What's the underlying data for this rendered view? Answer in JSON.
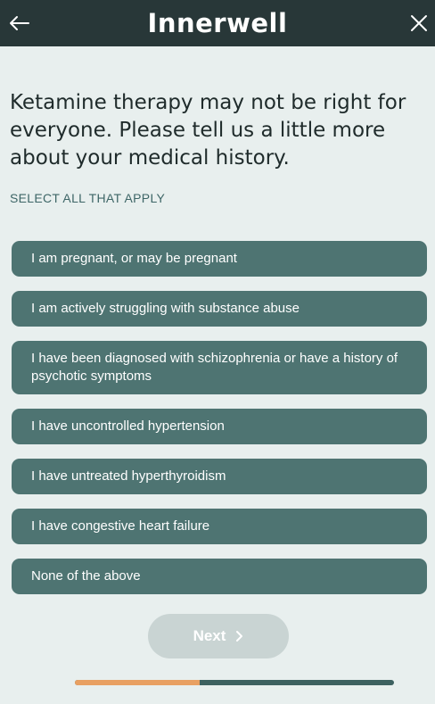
{
  "header": {
    "logo_text": "Innerwell",
    "back_icon": "arrow-left-icon",
    "close_icon": "close-icon"
  },
  "question": {
    "text": "Ketamine therapy may not be right for everyone. Please tell us a little more about your medical history.",
    "instruction": "SELECT ALL THAT APPLY"
  },
  "options": [
    {
      "label": "I am pregnant, or may be pregnant"
    },
    {
      "label": "I am actively struggling with substance abuse"
    },
    {
      "label": "I have been diagnosed with schizophrenia or have a history of psychotic symptoms"
    },
    {
      "label": "I have uncontrolled hypertension"
    },
    {
      "label": "I have untreated hyperthyroidism"
    },
    {
      "label": "I have congestive heart failure"
    },
    {
      "label": "None of the above"
    }
  ],
  "next_button": {
    "label": "Next",
    "disabled": true
  },
  "progress": {
    "fraction": 0.39
  },
  "colors": {
    "header_bg": "#283738",
    "option_bg": "#4e7472",
    "page_bg": "#e8efee",
    "progress_fill": "#e8a062",
    "progress_track": "#3d6160",
    "next_disabled_bg": "#c9d4d3"
  }
}
